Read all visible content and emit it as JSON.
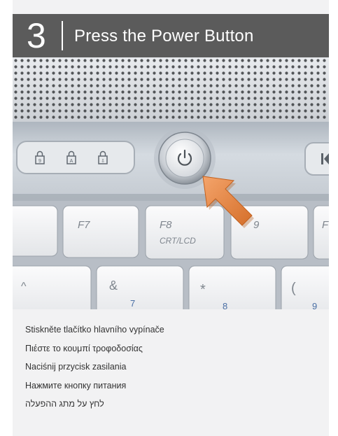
{
  "header": {
    "step_number": "3",
    "title": "Press the Power Button"
  },
  "photo": {
    "keys": {
      "f7": "F7",
      "f8": "F8",
      "f8_sub": "CRT/LCD",
      "f9_partial": "9",
      "f10_partial": "F",
      "caret": "^",
      "ampersand": "&",
      "seven": "7",
      "asterisk": "*",
      "eight": "8",
      "paren": "(",
      "nine": "9"
    },
    "indicators": [
      "9",
      "A",
      "⇩"
    ],
    "icons": [
      "padlock-icon",
      "padlock-icon",
      "padlock-icon",
      "power-icon",
      "media-prev-icon",
      "arrow-pointer-icon"
    ],
    "colors": {
      "header_bg": "#5b5b5b",
      "arrow": "#e8843f",
      "silver": "#d6dbe1"
    }
  },
  "captions": [
    "Stiskněte tlačítko hlavního vypínače",
    "Πιέστε το κουμπί τροφοδοσίας",
    "Naciśnij przycisk zasilania",
    "Нажмите кнопку питания",
    "לחץ על מתג ההפעלה"
  ]
}
